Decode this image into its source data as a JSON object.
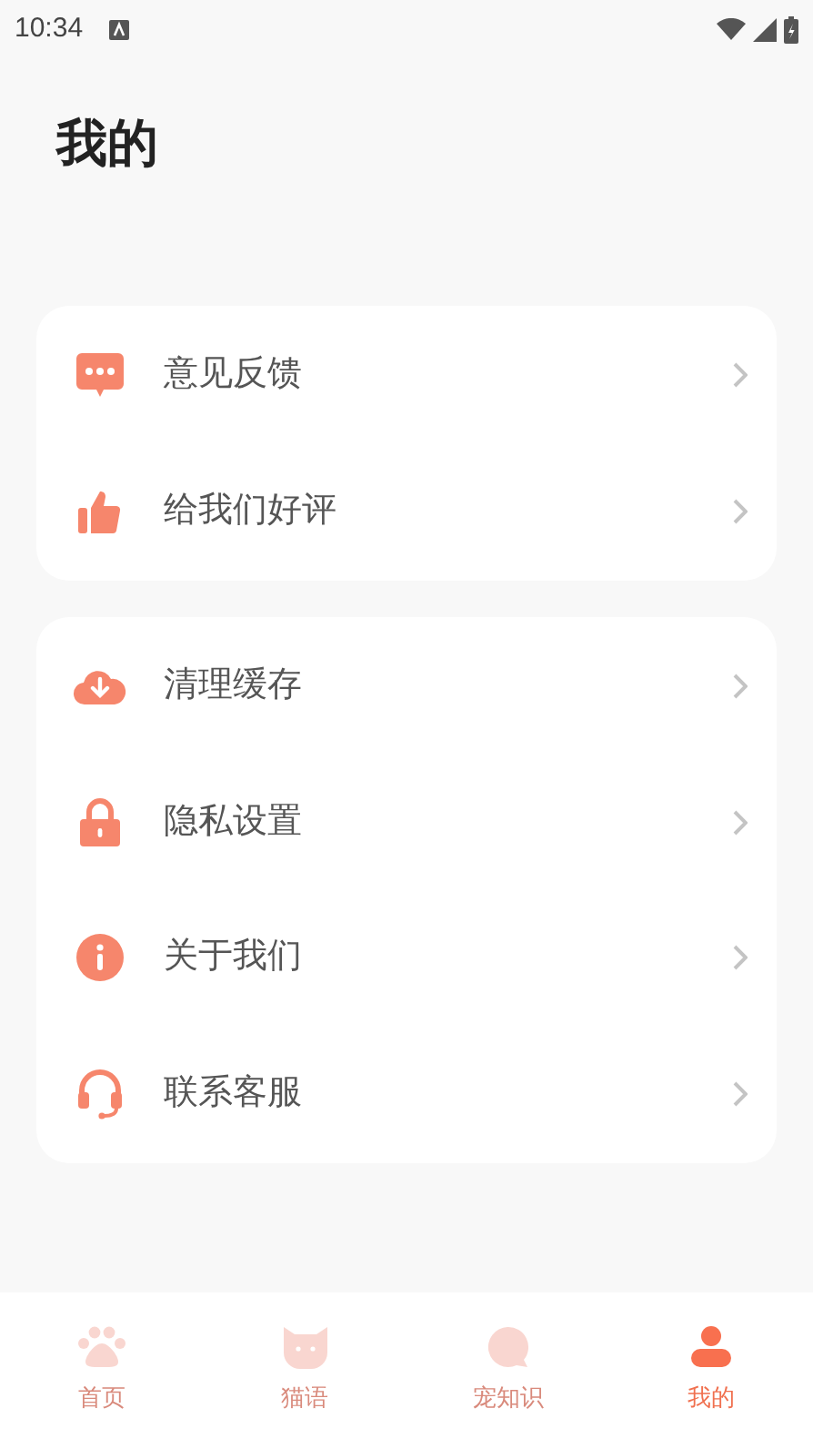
{
  "status_bar": {
    "time": "10:34"
  },
  "title": "我的",
  "groups": [
    {
      "items": [
        {
          "kind": "feedback",
          "label": "意见反馈"
        },
        {
          "kind": "thumb",
          "label": "给我们好评"
        }
      ]
    },
    {
      "items": [
        {
          "kind": "cloud",
          "label": "清理缓存"
        },
        {
          "kind": "lock",
          "label": "隐私设置"
        },
        {
          "kind": "info",
          "label": "关于我们"
        },
        {
          "kind": "headset",
          "label": "联系客服"
        }
      ]
    }
  ],
  "tab_bar": [
    {
      "kind": "paw",
      "label": "首页",
      "selected": false
    },
    {
      "kind": "cat",
      "label": "猫语",
      "selected": false
    },
    {
      "kind": "bubble",
      "label": "宠知识",
      "selected": false
    },
    {
      "kind": "person",
      "label": "我的",
      "selected": true
    }
  ]
}
